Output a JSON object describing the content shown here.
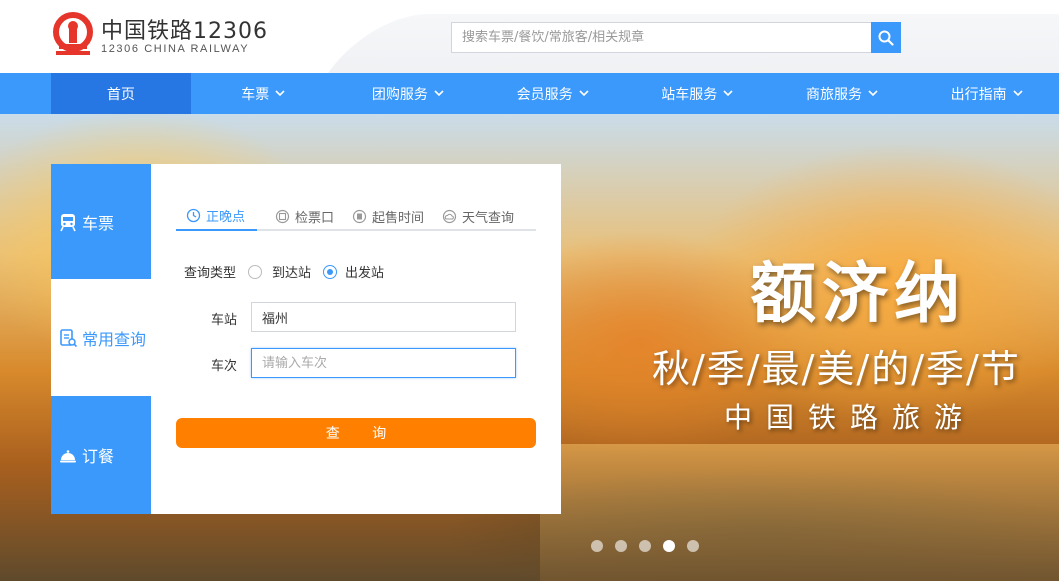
{
  "header": {
    "brand_cn": "中国铁路12306",
    "brand_en": "12306 CHINA RAILWAY",
    "search_placeholder": "搜索车票/餐饮/常旅客/相关规章",
    "logo_icon": "railway-logo-icon",
    "search_icon": "search-icon"
  },
  "nav": {
    "items": [
      {
        "label": "首页",
        "has_dropdown": false,
        "active": true
      },
      {
        "label": "车票",
        "has_dropdown": true
      },
      {
        "label": "团购服务",
        "has_dropdown": true
      },
      {
        "label": "会员服务",
        "has_dropdown": true
      },
      {
        "label": "站车服务",
        "has_dropdown": true
      },
      {
        "label": "商旅服务",
        "has_dropdown": true
      },
      {
        "label": "出行指南",
        "has_dropdown": true
      }
    ]
  },
  "panel": {
    "side_tabs": [
      {
        "label": "车票",
        "icon": "train-icon"
      },
      {
        "label": "常用查询",
        "icon": "query-list-icon",
        "active": true
      },
      {
        "label": "订餐",
        "icon": "food-cover-icon"
      }
    ],
    "tabs": [
      {
        "label": "正晚点",
        "icon": "clock-icon",
        "active": true
      },
      {
        "label": "检票口",
        "icon": "ticket-gate-icon"
      },
      {
        "label": "起售时间",
        "icon": "sale-time-icon"
      },
      {
        "label": "天气查询",
        "icon": "weather-icon"
      }
    ],
    "query_type_label": "查询类型",
    "radio_options": [
      {
        "label": "到达站",
        "checked": false
      },
      {
        "label": "出发站",
        "checked": true
      }
    ],
    "station_label": "车站",
    "station_value": "福州",
    "train_label": "车次",
    "train_placeholder": "请输入车次",
    "query_button": "查 询"
  },
  "banner": {
    "title": "额济纳",
    "subtitle": "秋/季/最/美/的/季/节",
    "tagline": "中国铁路旅游",
    "dots_count": 5,
    "active_dot": 3
  },
  "colors": {
    "primary": "#3b99fc",
    "nav_active": "#2676e3",
    "accent": "#ff8000",
    "logo_red": "#e6352a"
  }
}
